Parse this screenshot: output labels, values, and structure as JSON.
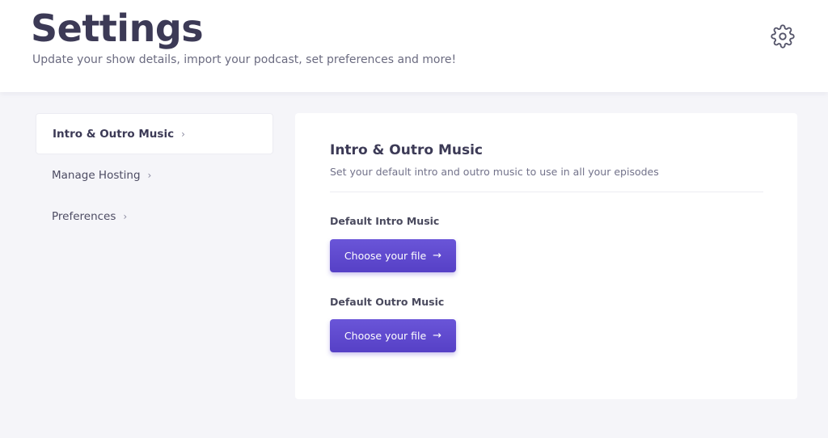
{
  "header": {
    "title": "Settings",
    "subtitle": "Update your show details, import your podcast, set preferences and more!",
    "settings_icon": "gear-icon"
  },
  "sidebar": {
    "items": [
      {
        "label": "Intro & Outro Music",
        "active": true
      },
      {
        "label": "Manage Hosting",
        "active": false
      },
      {
        "label": "Preferences",
        "active": false
      }
    ],
    "chevron": "›"
  },
  "panel": {
    "title": "Intro & Outro Music",
    "description": "Set your default intro and outro music to use in all your episodes",
    "intro": {
      "label": "Default Intro Music",
      "button_label": "Choose your file"
    },
    "outro": {
      "label": "Default Outro Music",
      "button_label": "Choose your file"
    },
    "arrow": "→"
  },
  "colors": {
    "accent": "#5a45cc",
    "title": "#3c3a56",
    "background": "#f5f5f9"
  }
}
